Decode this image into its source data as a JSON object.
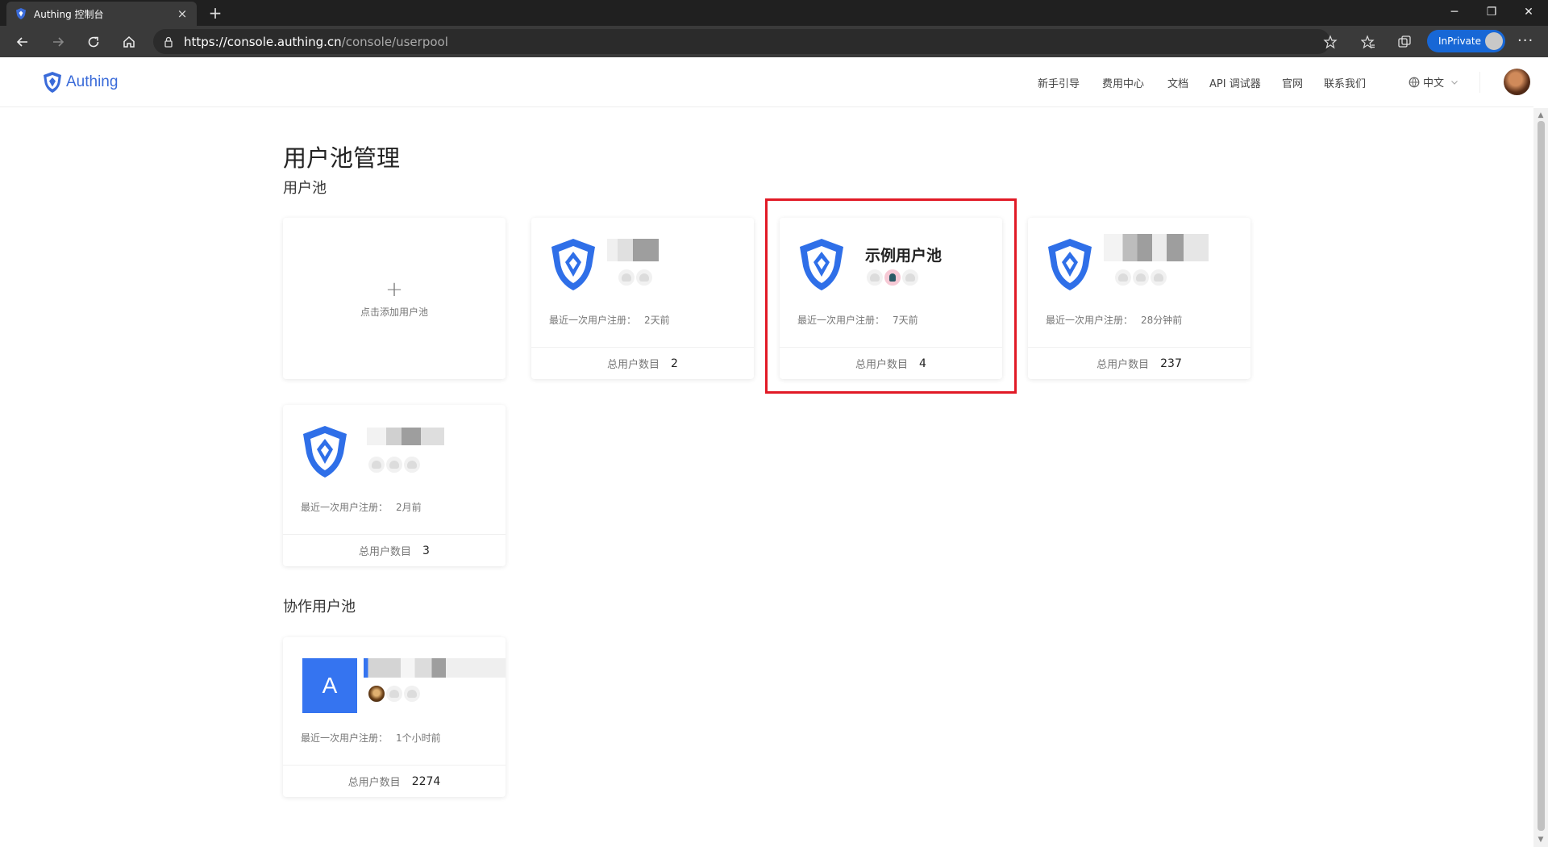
{
  "browser": {
    "tab_title": "Authing 控制台",
    "url_main": "https://console.authing.cn",
    "url_path": "/console/userpool",
    "inprivate_label": "InPrivate"
  },
  "header": {
    "logo_text": "Authing",
    "menu": [
      "新手引导",
      "费用中心",
      "文档",
      "API 调试器",
      "官网",
      "联系我们"
    ],
    "language": "中文"
  },
  "main": {
    "page_title": "用户池管理",
    "pools_section_title": "用户池",
    "add_pool_label": "点击添加用户池",
    "last_register_label": "最近一次用户注册：",
    "total_users_label": "总用户数目",
    "pools": [
      {
        "name": "",
        "last_register": "2天前",
        "total": "2"
      },
      {
        "name": "示例用户池",
        "last_register": "7天前",
        "total": "4"
      },
      {
        "name": "",
        "last_register": "28分钟前",
        "total": "237"
      },
      {
        "name": "",
        "last_register": "2月前",
        "total": "3"
      }
    ],
    "collab_section_title": "协作用户池",
    "collab_pools": [
      {
        "avatar_letter": "A",
        "last_register": "1个小时前",
        "total": "2274"
      }
    ]
  },
  "colors": {
    "brand": "#3a6bd9",
    "highlight": "#e11a26",
    "inprivate": "#1767d6"
  }
}
